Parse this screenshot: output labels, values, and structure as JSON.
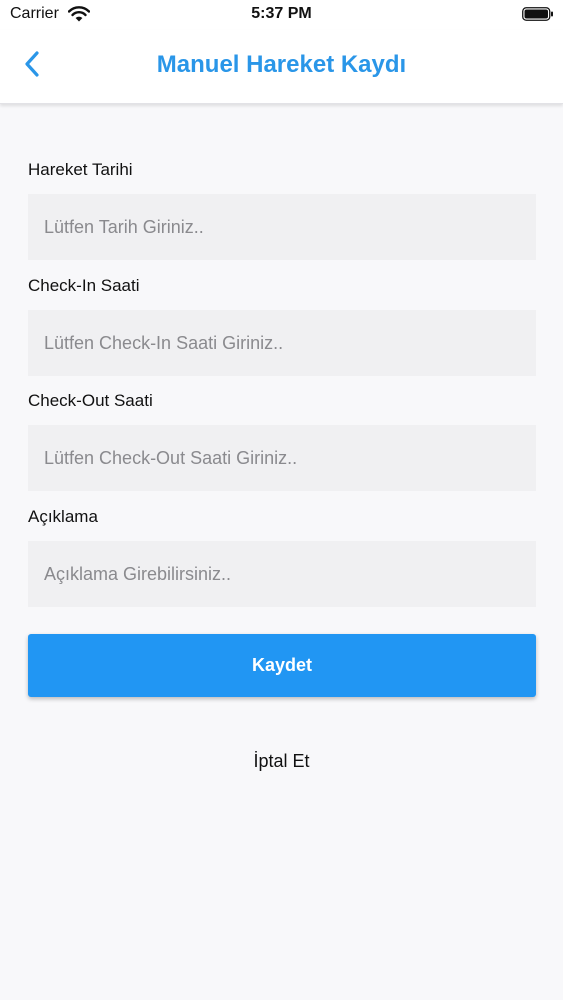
{
  "status_bar": {
    "carrier": "Carrier",
    "time": "5:37 PM",
    "wifi_icon": "wifi-icon",
    "battery_icon": "battery-icon"
  },
  "nav": {
    "back_icon": "chevron-left-icon",
    "title": "Manuel Hareket Kaydı"
  },
  "form": {
    "fields": [
      {
        "label": "Hareket Tarihi",
        "value": "",
        "placeholder": "Lütfen Tarih Giriniz.."
      },
      {
        "label": "Check-In Saati",
        "value": "",
        "placeholder": "Lütfen Check-In Saati Giriniz.."
      },
      {
        "label": "Check-Out Saati",
        "value": "",
        "placeholder": "Lütfen Check-Out Saati Giriniz.."
      },
      {
        "label": "Açıklama",
        "value": "",
        "placeholder": "Açıklama Girebilirsiniz.."
      }
    ],
    "save_label": "Kaydet",
    "cancel_label": "İptal Et"
  },
  "colors": {
    "accent": "#2196f3",
    "title": "#2a96e8",
    "background": "#f8f8fa",
    "input_background": "#f0f0f2"
  }
}
